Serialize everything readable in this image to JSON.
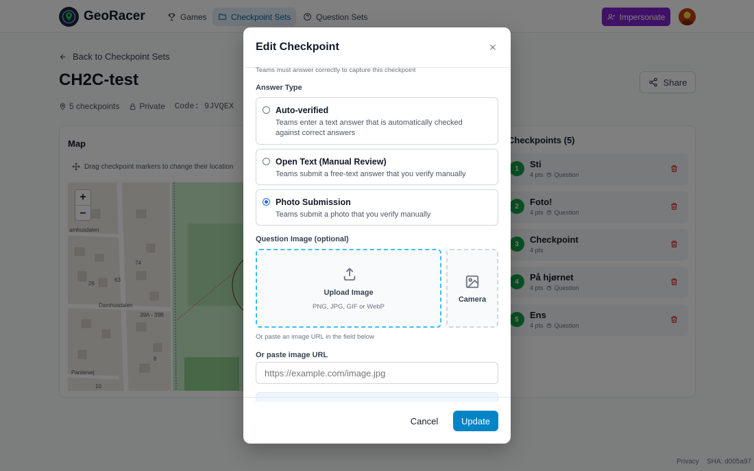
{
  "app": {
    "name": "GeoRacer"
  },
  "nav": [
    {
      "label": "Games"
    },
    {
      "label": "Checkpoint Sets"
    },
    {
      "label": "Question Sets"
    }
  ],
  "header": {
    "impersonate_label": "Impersonate"
  },
  "page": {
    "back_label": "Back to Checkpoint Sets",
    "title": "CH2C-test",
    "checkpoint_count": "5 checkpoints",
    "visibility": "Private",
    "code": "Code: 9JVQEX",
    "share_label": "Share"
  },
  "map": {
    "title": "Map",
    "hint": "Drag checkpoint markers to change their location",
    "zoom_in": "+",
    "zoom_out": "−",
    "street_labels": [
      "Damhusdalen",
      "amhusdalen",
      "Damhusdalen",
      "Pantervej",
      "39A - 39B",
      "63",
      "74",
      "26",
      "8",
      "10"
    ]
  },
  "checkpoints": {
    "title": "Checkpoints (5)",
    "items": [
      {
        "num": "1",
        "name": "Sti",
        "points": "4 pts",
        "type": "Question"
      },
      {
        "num": "2",
        "name": "Foto!",
        "points": "4 pts",
        "type": "Question"
      },
      {
        "num": "3",
        "name": "Checkpoint",
        "points": "4 pts",
        "type": ""
      },
      {
        "num": "4",
        "name": "På hjørnet",
        "points": "4 pts",
        "type": "Question"
      },
      {
        "num": "5",
        "name": "Ens",
        "points": "4 pts",
        "type": "Question"
      }
    ]
  },
  "footer": {
    "privacy": "Privacy",
    "sha": "SHA: d005a97"
  },
  "modal": {
    "title": "Edit Checkpoint",
    "top_note": "Teams must answer correctly to capture this checkpoint",
    "answer_type_label": "Answer Type",
    "options": [
      {
        "title": "Auto-verified",
        "desc": "Teams enter a text answer that is automatically checked against correct answers",
        "checked": false
      },
      {
        "title": "Open Text (Manual Review)",
        "desc": "Teams submit a free-text answer that you verify manually",
        "checked": false
      },
      {
        "title": "Photo Submission",
        "desc": "Teams submit a photo that you verify manually",
        "checked": true
      }
    ],
    "image_label": "Question Image (optional)",
    "upload_title": "Upload Image",
    "upload_formats": "PNG, JPG, GIF or WebP",
    "camera_label": "Camera",
    "paste_note": "Or paste an image URL in the field below",
    "url_label": "Or paste image URL",
    "url_placeholder": "https://example.com/image.jpg",
    "cancel_label": "Cancel",
    "update_label": "Update"
  },
  "colors": {
    "primary": "#0284c7",
    "impersonate": "#7e22ce",
    "checkpoint_badge": "#16a34a",
    "nav_active_bg": "#e0ecf8"
  }
}
